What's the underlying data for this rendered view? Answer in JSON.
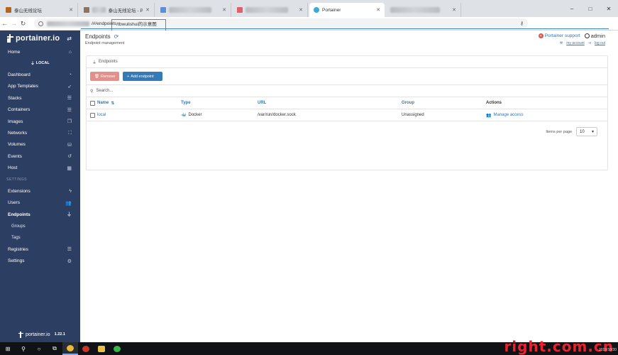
{
  "browser": {
    "tabs": [
      {
        "label": "泰山无线论坛",
        "color": "#b3651f"
      },
      {
        "label": "泰山无线论坛 - Pow",
        "color": "#8a7563"
      },
      {
        "label": "",
        "color": "#5d8fd6"
      },
      {
        "label": "",
        "color": "#e35d6a"
      },
      {
        "label": "Portainer",
        "color": "#3ba9dc"
      },
      {
        "label": "",
        "color": "#a8b2a3"
      }
    ],
    "window_controls": [
      "–",
      "□",
      "✕"
    ],
    "url_path": "/#/endpoints",
    "url_annotation": "/tbwulishui的示意图",
    "key_icon": "key-icon"
  },
  "sidebar": {
    "logo_text": "portainer.io",
    "toggle_icon": "exchange-icon",
    "home": {
      "label": "Home",
      "icon": "home-icon"
    },
    "local_label": "LOCAL",
    "items": [
      {
        "label": "Dashboard",
        "icon": "tachometer-icon",
        "glyph": "◔"
      },
      {
        "label": "App Templates",
        "icon": "rocket-icon",
        "glyph": "➶"
      },
      {
        "label": "Stacks",
        "icon": "th-list-icon",
        "glyph": "☰"
      },
      {
        "label": "Containers",
        "icon": "server-icon",
        "glyph": "☰"
      },
      {
        "label": "Images",
        "icon": "clone-icon",
        "glyph": "❐"
      },
      {
        "label": "Networks",
        "icon": "sitemap-icon",
        "glyph": "⛶"
      },
      {
        "label": "Volumes",
        "icon": "cubes-icon",
        "glyph": "⛁"
      },
      {
        "label": "Events",
        "icon": "history-icon",
        "glyph": "↺"
      },
      {
        "label": "Host",
        "icon": "th-icon",
        "glyph": "▦"
      }
    ],
    "settings_section": "SETTINGS",
    "settings_items": [
      {
        "label": "Extensions",
        "icon": "bolt-icon",
        "glyph": "ϟ"
      },
      {
        "label": "Users",
        "icon": "users-icon",
        "glyph": "👥"
      },
      {
        "label": "Endpoints",
        "icon": "plug-icon",
        "glyph": "⏚"
      }
    ],
    "endpoint_subitems": [
      "Groups",
      "Tags"
    ],
    "after_items": [
      {
        "label": "Registries",
        "icon": "database-icon",
        "glyph": "☰"
      },
      {
        "label": "Settings",
        "icon": "cogs-icon",
        "glyph": "⚙"
      }
    ],
    "footer_logo": "portainer.io",
    "version": "1.22.1"
  },
  "header": {
    "title": "Endpoints",
    "subtitle": "Endpoint management",
    "support_label": "Portainer support",
    "user_label": "admin",
    "my_account": "my account",
    "log_out": "log out"
  },
  "panel": {
    "title": "Endpoints",
    "remove_label": "Remove",
    "add_label": "Add endpoint",
    "search_placeholder": "Search...",
    "columns": {
      "name": "Name",
      "type": "Type",
      "url": "URL",
      "group": "Group",
      "actions": "Actions"
    },
    "rows": [
      {
        "name": "local",
        "type": "Docker",
        "url": "/var/run/docker.sock",
        "group": "Unassigned",
        "action": "Manage access"
      }
    ],
    "items_per_page_label": "Items per page",
    "items_per_page_value": "10"
  },
  "taskbar": {
    "items": [
      "windows-start-icon",
      "search-icon",
      "cortana-icon",
      "task-view-icon",
      "chrome-icon",
      "app-icon",
      "file-explorer-icon",
      "wechat-icon"
    ],
    "clock": "2019/10/30"
  },
  "watermark": "right.com.cn"
}
